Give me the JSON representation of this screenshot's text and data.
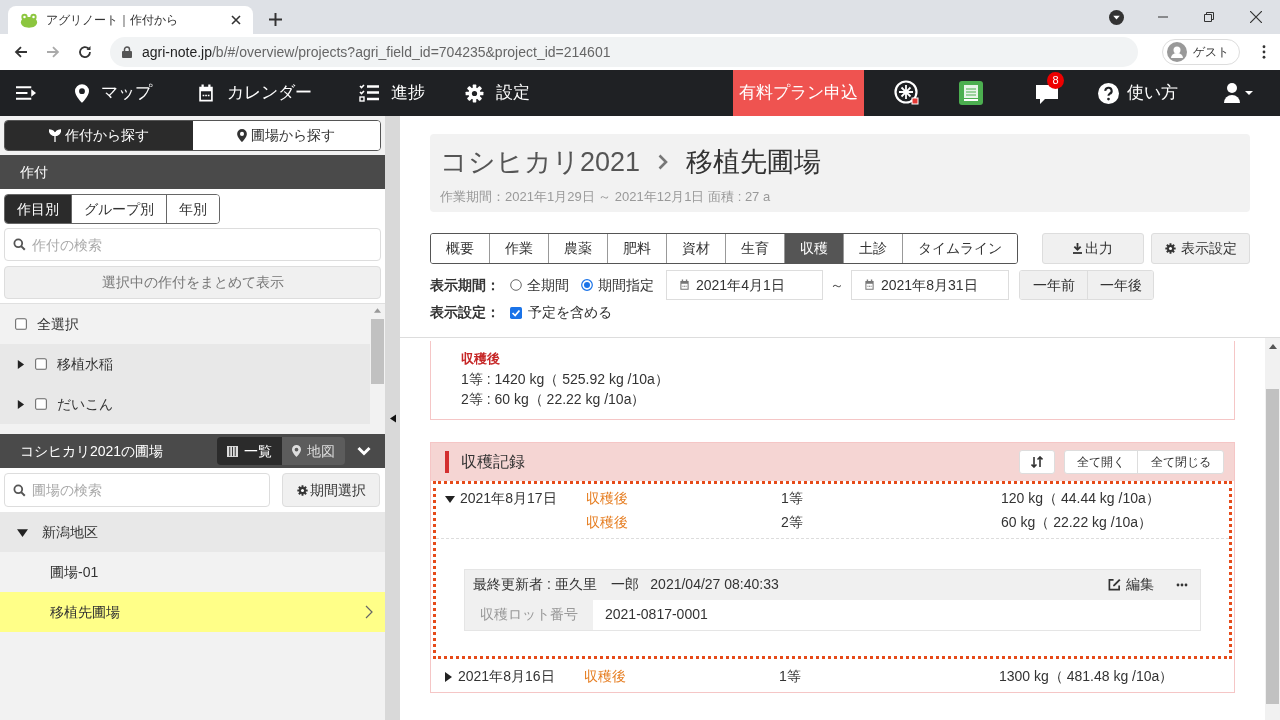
{
  "browser": {
    "tab_title": "アグリノート｜作付から",
    "url_host": "agri-note.jp",
    "url_path": "/b/#/overview/projects?agri_field_id=704235&project_id=214601",
    "profile": "ゲスト"
  },
  "nav": {
    "items": [
      {
        "kind": "map",
        "label": "マップ"
      },
      {
        "kind": "calendar",
        "label": "カレンダー"
      },
      {
        "kind": "progress",
        "label": "進捗"
      },
      {
        "kind": "settings",
        "label": "設定"
      }
    ],
    "plan_button": "有料プラン申込",
    "notification_count": "8",
    "help": "使い方"
  },
  "sidebar": {
    "search_tabs": [
      {
        "kind": "crop",
        "label": "作付から探す",
        "selected": true
      },
      {
        "kind": "field",
        "label": "圃場から探す",
        "selected": false
      }
    ],
    "crop_header": "作付",
    "filter_tabs": [
      {
        "label": "作目別",
        "selected": true
      },
      {
        "label": "グループ別",
        "selected": false
      },
      {
        "label": "年別",
        "selected": false
      }
    ],
    "crop_search_placeholder": "作付の検索",
    "show_selected_button": "選択中の作付をまとめて表示",
    "select_all": {
      "label": "全選択",
      "checked": false
    },
    "crops": [
      {
        "label": "移植水稲",
        "checked": false
      },
      {
        "label": "だいこん",
        "checked": false
      }
    ],
    "fields_header": "コシヒカリ2021の圃場",
    "view_toggle": [
      {
        "kind": "list",
        "label": "一覧",
        "selected": true
      },
      {
        "kind": "map",
        "label": "地図",
        "selected": false
      }
    ],
    "field_search_placeholder": "圃場の検索",
    "period_button": "期間選択",
    "tree": [
      {
        "label": "新潟地区",
        "expanded": true,
        "children": [
          {
            "label": "圃場-01",
            "selected": false
          },
          {
            "label": "移植先圃場",
            "selected": true
          }
        ]
      }
    ]
  },
  "main": {
    "crop": "コシヒカリ2021",
    "field": "移植先圃場",
    "subtitle": "作業期間：2021年1月29日 ～ 2021年12月1日  面積 : 27 a",
    "tabs": [
      {
        "label": "概要",
        "selected": false
      },
      {
        "label": "作業",
        "selected": false
      },
      {
        "label": "農薬",
        "selected": false
      },
      {
        "label": "肥料",
        "selected": false
      },
      {
        "label": "資材",
        "selected": false
      },
      {
        "label": "生育",
        "selected": false
      },
      {
        "label": "収穫",
        "selected": true
      },
      {
        "label": "土診",
        "selected": false
      },
      {
        "label": "タイムライン",
        "selected": false
      }
    ],
    "export_button": "出力",
    "display_settings_button": "表示設定",
    "period_label": "表示期間：",
    "period_options": [
      {
        "label": "全期間",
        "selected": false
      },
      {
        "label": "期間指定",
        "selected": true
      }
    ],
    "date_from": "2021年4月1日",
    "date_separator": "～",
    "date_to": "2021年8月31日",
    "prev_year": "一年前",
    "next_year": "一年後",
    "settings_label": "表示設定：",
    "include_planned": {
      "label": "予定を含める",
      "checked": true
    },
    "summary": {
      "heading": "収穫後",
      "lines": [
        "1等 : 1420 kg（ 525.92 kg /10a）",
        "2等 : 60 kg（ 22.22 kg /10a）"
      ]
    },
    "records": {
      "title": "収穫記録",
      "expand_all": "全て開く",
      "collapse_all": "全て閉じる",
      "rows": [
        {
          "date": "2021年8月17日",
          "expanded": true,
          "entries": [
            {
              "stage": "収穫後",
              "grade": "1等",
              "amount": "120 kg（ 44.44 kg /10a）"
            },
            {
              "stage": "収穫後",
              "grade": "2等",
              "amount": "60 kg（ 22.22 kg /10a）"
            }
          ],
          "detail": {
            "updater": "最終更新者 : 亜久里　一郎   2021/04/27 08:40:33",
            "edit": "編集",
            "lot_label": "収穫ロット番号",
            "lot_value": "2021-0817-0001"
          }
        },
        {
          "date": "2021年8月16日",
          "expanded": false,
          "entries": [
            {
              "stage": "収穫後",
              "grade": "1等",
              "amount": "1300 kg（ 481.48 kg /10a）"
            }
          ]
        }
      ]
    }
  }
}
